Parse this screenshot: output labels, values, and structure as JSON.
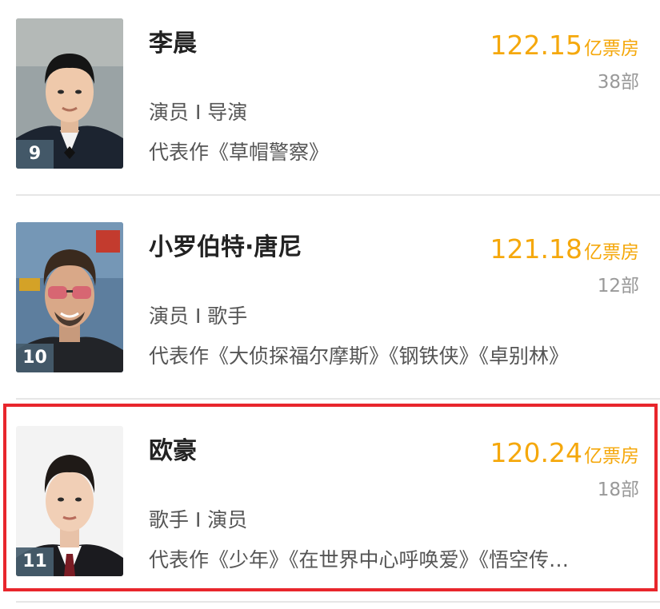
{
  "ranking": [
    {
      "rank": "9",
      "name": "李晨",
      "box_office_number": "122.15",
      "box_office_unit": "亿票房",
      "film_count": "38部",
      "roles": "演员 I 导演",
      "works": "代表作《草帽警察》"
    },
    {
      "rank": "10",
      "name": "小罗伯特·唐尼",
      "box_office_number": "121.18",
      "box_office_unit": "亿票房",
      "film_count": "12部",
      "roles": "演员 I 歌手",
      "works": "代表作《大侦探福尔摩斯》《钢铁侠》《卓别林》"
    },
    {
      "rank": "11",
      "name": "欧豪",
      "box_office_number": "120.24",
      "box_office_unit": "亿票房",
      "film_count": "18部",
      "roles": "歌手 I 演员",
      "works": "代表作《少年》《在世界中心呼唤爱》《悟空传…"
    }
  ],
  "colors": {
    "box_office": "#f5a80c",
    "highlight_border": "#e8262c",
    "rank_badge": "#475d6e"
  }
}
